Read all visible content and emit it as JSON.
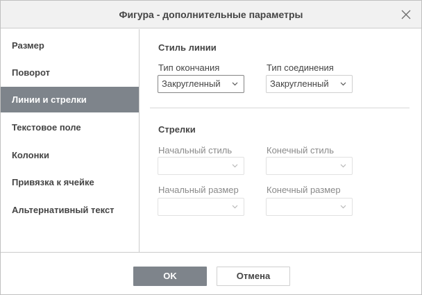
{
  "dialog": {
    "title": "Фигура - дополнительные параметры"
  },
  "sidebar": {
    "items": [
      {
        "label": "Размер"
      },
      {
        "label": "Поворот"
      },
      {
        "label": "Линии и стрелки"
      },
      {
        "label": "Текстовое поле"
      },
      {
        "label": "Колонки"
      },
      {
        "label": "Привязка к ячейке"
      },
      {
        "label": "Альтернативный текст"
      }
    ],
    "active_index": 2
  },
  "line_style": {
    "heading": "Стиль линии",
    "cap_label": "Тип окончания",
    "cap_value": "Закругленный",
    "join_label": "Тип соединения",
    "join_value": "Закругленный"
  },
  "arrows": {
    "heading": "Стрелки",
    "begin_style_label": "Начальный стиль",
    "end_style_label": "Конечный стиль",
    "begin_size_label": "Начальный размер",
    "end_size_label": "Конечный размер"
  },
  "footer": {
    "ok_label": "OK",
    "cancel_label": "Отмена"
  },
  "colors": {
    "accent": "#7e848b",
    "title_bar": "#f1f1f1",
    "border": "#cbcbcb"
  },
  "icons": {
    "close": "close-icon",
    "dropdown": "chevron-down-icon"
  }
}
